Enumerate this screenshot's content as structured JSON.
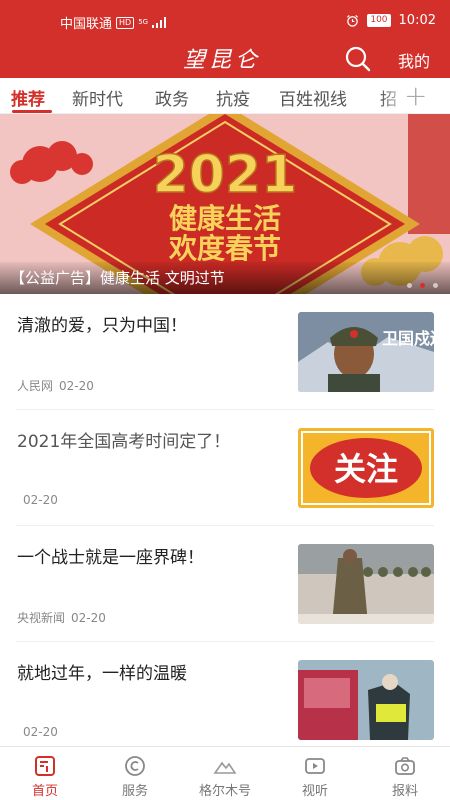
{
  "status_bar": {
    "carrier": "中国联通",
    "hd": "HD",
    "signal": "5G",
    "battery": "100",
    "time": "10:02"
  },
  "header": {
    "logo": "望昆仑",
    "mine_label": "我的"
  },
  "tabs": [
    {
      "label": "推荐",
      "active": true
    },
    {
      "label": "新时代",
      "active": false
    },
    {
      "label": "政务",
      "active": false
    },
    {
      "label": "抗疫",
      "active": false
    },
    {
      "label": "百姓视线",
      "active": false
    },
    {
      "label": "招",
      "active": false
    }
  ],
  "banner": {
    "year": "2021",
    "line1": "健康生活",
    "line2": "欢度春节",
    "caption": "【公益广告】健康生活 文明过节",
    "dots": 3,
    "active_dot": 1
  },
  "news": [
    {
      "title": "清澈的爱，只为中国！",
      "source": "人民网",
      "date": "02-20",
      "thumb_text": "卫国戍边"
    },
    {
      "title": "2021年全国高考时间定了！",
      "source": "",
      "date": "02-20",
      "thumb_text": "关注"
    },
    {
      "title": "一个战士就是一座界碑！",
      "source": "央视新闻",
      "date": "02-20",
      "thumb_text": ""
    },
    {
      "title": "就地过年，一样的温暖",
      "source": "",
      "date": "02-20",
      "thumb_text": ""
    }
  ],
  "bottom_nav": [
    {
      "label": "首页",
      "icon": "home-icon",
      "active": true
    },
    {
      "label": "服务",
      "icon": "service-icon",
      "active": false
    },
    {
      "label": "格尔木号",
      "icon": "mountain-icon",
      "active": false
    },
    {
      "label": "视听",
      "icon": "video-icon",
      "active": false
    },
    {
      "label": "报料",
      "icon": "camera-icon",
      "active": false
    }
  ],
  "colors": {
    "brand_red": "#d4302b",
    "gold": "#f6d25b",
    "banner_bg": "#f3c9c6"
  }
}
